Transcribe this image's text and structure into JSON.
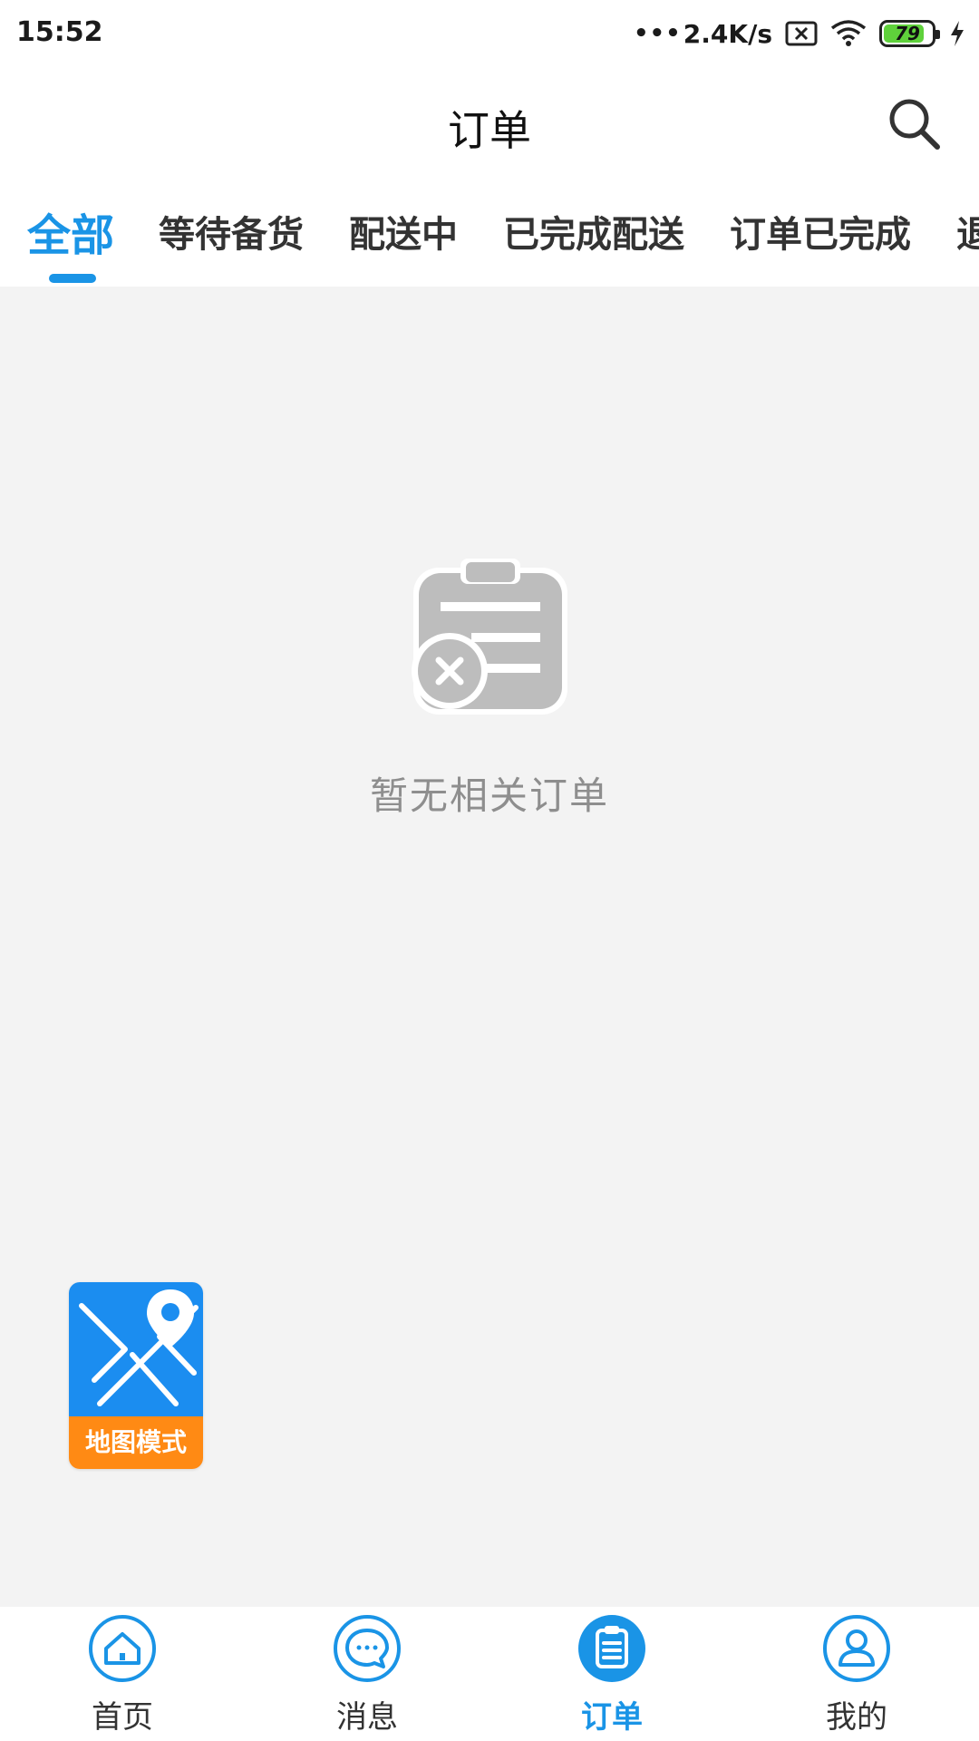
{
  "status_bar": {
    "time": "15:52",
    "net_dots": "•••",
    "net_speed": "2.4K/s",
    "battery": "79"
  },
  "header": {
    "title": "订单",
    "search_icon": "search-icon"
  },
  "tabs": [
    {
      "label": "全部",
      "active": true
    },
    {
      "label": "等待备货"
    },
    {
      "label": "配送中"
    },
    {
      "label": "已完成配送"
    },
    {
      "label": "订单已完成"
    },
    {
      "label": "退"
    }
  ],
  "empty_state": {
    "icon": "clipboard-x-icon",
    "text": "暂无相关订单"
  },
  "map_mode": {
    "label": "地图模式",
    "icon": "map-pin-icon"
  },
  "bottom_nav": [
    {
      "label": "首页",
      "icon": "home-icon"
    },
    {
      "label": "消息",
      "icon": "message-icon"
    },
    {
      "label": "订单",
      "icon": "clipboard-icon",
      "active": true
    },
    {
      "label": "我的",
      "icon": "user-icon"
    }
  ],
  "colors": {
    "accent": "#1a94e6",
    "map_blue": "#1b8df0",
    "map_orange": "#ff8a14",
    "background": "#f3f3f3"
  }
}
